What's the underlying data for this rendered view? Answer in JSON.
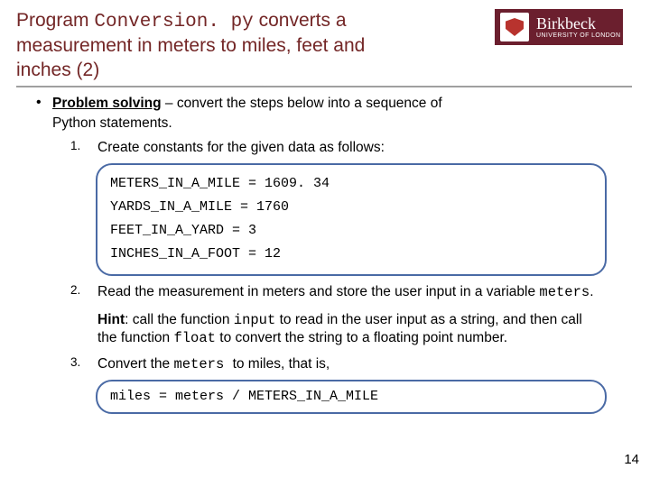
{
  "title_prefix": "Program ",
  "title_code": "Conversion. py",
  "title_suffix": " converts a measurement in meters to miles, feet and inches (2)",
  "logo": {
    "name": "Birkbeck",
    "sub": "UNIVERSITY OF LONDON"
  },
  "bullet_lead": "Problem solving",
  "bullet_rest": " – convert the steps below into a sequence of",
  "bullet_line2": "Python statements.",
  "step1_num": "1.",
  "step1_text": "Create constants for the given data as follows:",
  "code1_lines": [
    "METERS_IN_A_MILE = 1609. 34",
    "YARDS_IN_A_MILE = 1760",
    "FEET_IN_A_YARD = 3",
    "INCHES_IN_A_FOOT = 12"
  ],
  "step2_num": "2.",
  "step2_a": "Read  the measurement in meters and store the user input in a variable ",
  "step2_code": "meters",
  "step2_b": ".",
  "hint_label": "Hint",
  "hint_a": ": call the function ",
  "hint_c1": "input",
  "hint_b": " to read in the user input as a string, and then call the function ",
  "hint_c2": "float",
  "hint_c": " to convert the string to a floating point number.",
  "step3_num": "3.",
  "step3_a": "Convert the ",
  "step3_code": "meters ",
  "step3_b": " to miles, that is,",
  "code3": "miles =  meters / METERS_IN_A_MILE",
  "page": "14"
}
